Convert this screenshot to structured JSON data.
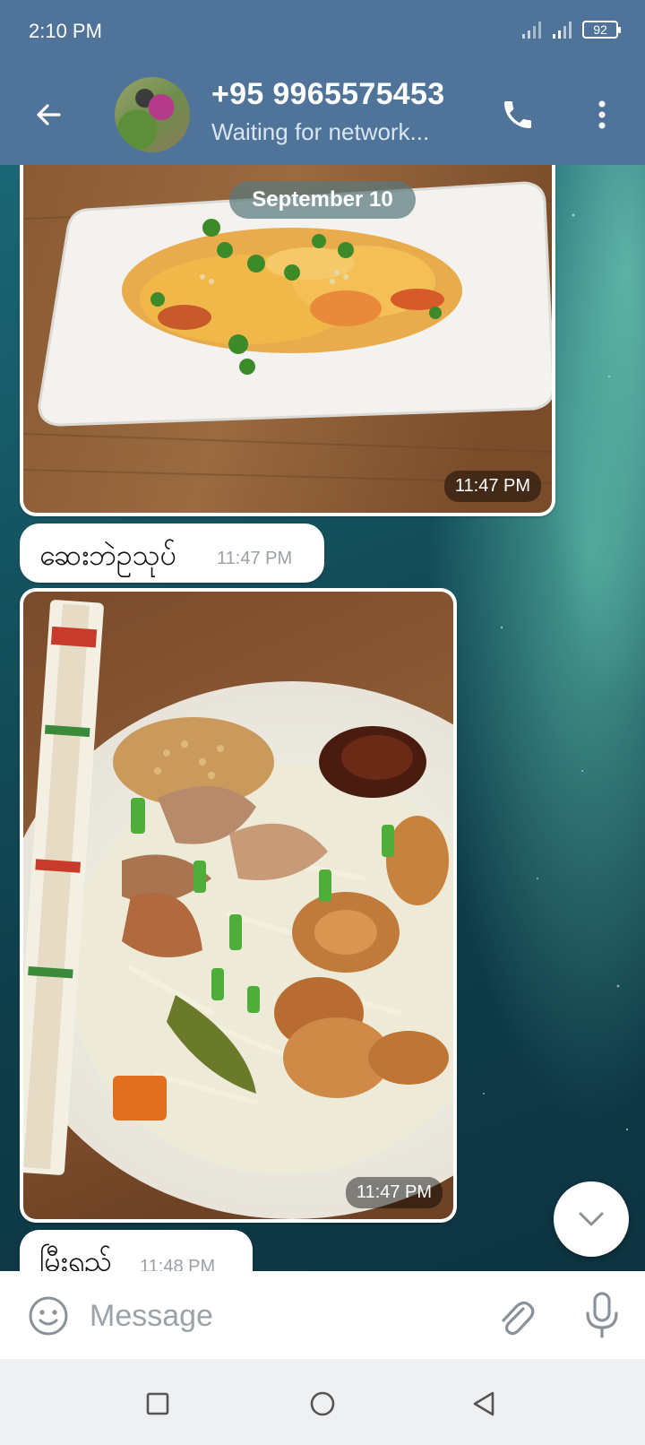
{
  "status_bar": {
    "time": "2:10 PM",
    "battery": "92"
  },
  "header": {
    "contact_name": "+95 9965575453",
    "contact_status": "Waiting for network..."
  },
  "chat": {
    "date_separator": "September 10",
    "messages": [
      {
        "kind": "photo",
        "time": "11:47 PM"
      },
      {
        "kind": "text",
        "text": "ဆေးဘဲဥသုပ်",
        "time": "11:47 PM"
      },
      {
        "kind": "photo",
        "time": "11:47 PM"
      },
      {
        "kind": "text",
        "text": "မြီးရှည်",
        "time": "11:48 PM"
      }
    ]
  },
  "composer": {
    "placeholder": "Message"
  },
  "icons": {
    "back": "arrow-left-icon",
    "call": "phone-icon",
    "menu": "more-vertical-icon",
    "emoji": "smiley-icon",
    "attach": "paperclip-icon",
    "mic": "microphone-icon",
    "scroll_down": "chevron-down-icon"
  },
  "colors": {
    "header": "#4f7399",
    "bubble": "#ffffff",
    "time_text": "#9aa0a6",
    "nav_bar": "#eef0f2"
  }
}
